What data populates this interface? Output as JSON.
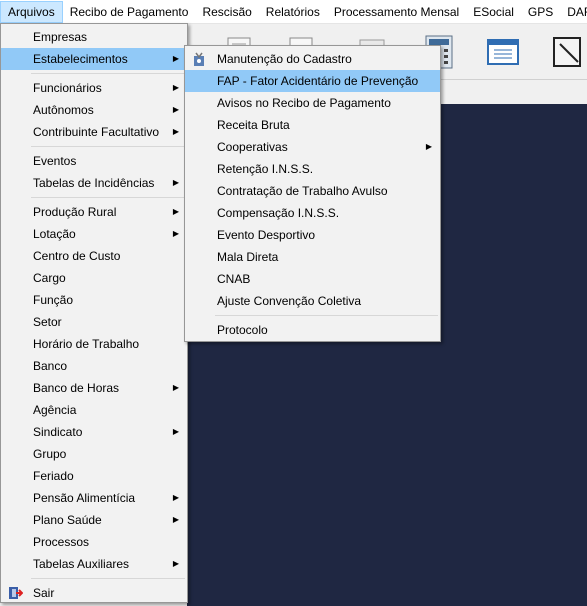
{
  "menubar": {
    "items": [
      {
        "label": "Arquivos"
      },
      {
        "label": "Recibo de Pagamento"
      },
      {
        "label": "Rescisão"
      },
      {
        "label": "Relatórios"
      },
      {
        "label": "Processamento Mensal"
      },
      {
        "label": "ESocial"
      },
      {
        "label": "GPS"
      },
      {
        "label": "DARF"
      }
    ]
  },
  "arquivos_menu": {
    "items": [
      {
        "label": "Empresas"
      },
      {
        "label": "Estabelecimentos"
      },
      {
        "label": "Funcionários"
      },
      {
        "label": "Autônomos"
      },
      {
        "label": "Contribuinte Facultativo"
      },
      {
        "label": "Eventos"
      },
      {
        "label": "Tabelas de Incidências"
      },
      {
        "label": "Produção Rural"
      },
      {
        "label": "Lotação"
      },
      {
        "label": "Centro de Custo"
      },
      {
        "label": "Cargo"
      },
      {
        "label": "Função"
      },
      {
        "label": "Setor"
      },
      {
        "label": "Horário de Trabalho"
      },
      {
        "label": "Banco"
      },
      {
        "label": "Banco de Horas"
      },
      {
        "label": "Agência"
      },
      {
        "label": "Sindicato"
      },
      {
        "label": "Grupo"
      },
      {
        "label": "Feriado"
      },
      {
        "label": "Pensão Alimentícia"
      },
      {
        "label": "Plano Saúde"
      },
      {
        "label": "Processos"
      },
      {
        "label": "Tabelas Auxiliares"
      },
      {
        "label": "Sair"
      }
    ]
  },
  "estabelecimentos_menu": {
    "items": [
      {
        "label": "Manutenção do Cadastro"
      },
      {
        "label": "FAP - Fator Acidentário de Prevenção"
      },
      {
        "label": "Avisos no Recibo de Pagamento"
      },
      {
        "label": "Receita Bruta"
      },
      {
        "label": "Cooperativas"
      },
      {
        "label": "Retenção I.N.S.S."
      },
      {
        "label": "Contratação de Trabalho Avulso"
      },
      {
        "label": "Compensação I.N.S.S."
      },
      {
        "label": "Evento Desportivo"
      },
      {
        "label": "Mala Direta"
      },
      {
        "label": "CNAB"
      },
      {
        "label": "Ajuste Convenção Coletiva"
      },
      {
        "label": "Protocolo"
      }
    ]
  },
  "colors": {
    "highlight": "#91c9f7",
    "menubar_active": "#cce8ff",
    "workspace": "#1f2742"
  }
}
